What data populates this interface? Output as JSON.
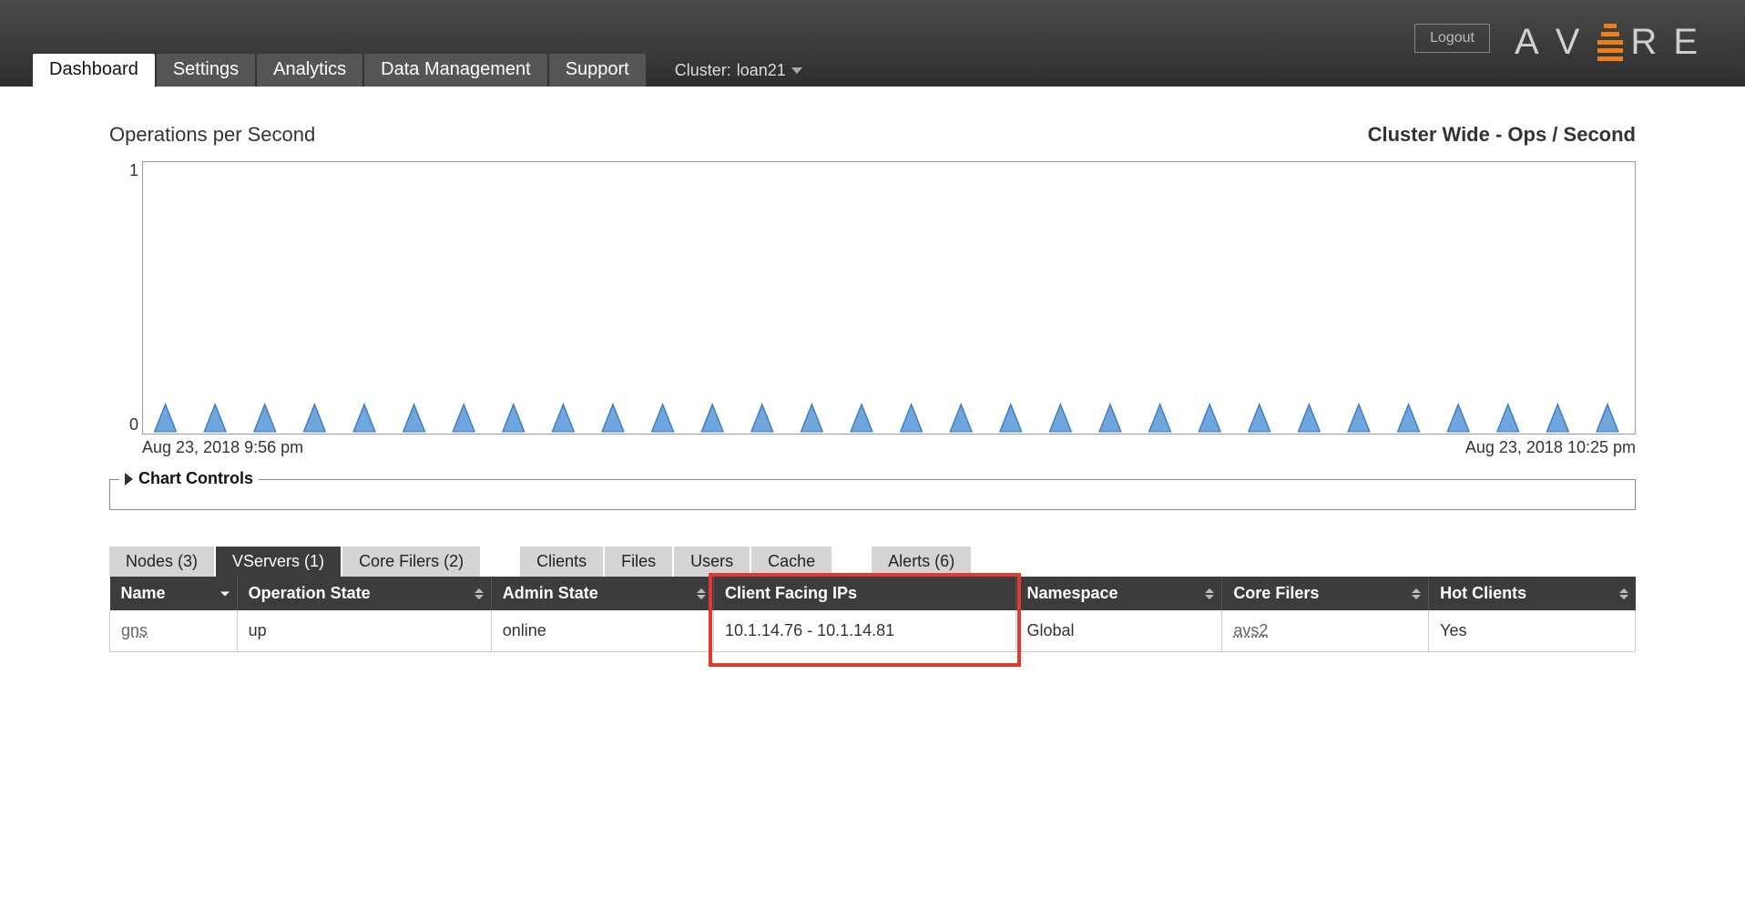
{
  "header": {
    "logout": "Logout",
    "cluster_label": "Cluster:",
    "cluster_name": "loan21",
    "tabs": [
      {
        "label": "Dashboard",
        "active": true
      },
      {
        "label": "Settings",
        "active": false
      },
      {
        "label": "Analytics",
        "active": false
      },
      {
        "label": "Data Management",
        "active": false
      },
      {
        "label": "Support",
        "active": false
      }
    ]
  },
  "chart": {
    "title": "Operations per Second",
    "subtitle": "Cluster Wide - Ops / Second",
    "y_min": "0",
    "y_max": "1",
    "x_start": "Aug 23, 2018 9:56 pm",
    "x_end": "Aug 23, 2018 10:25 pm",
    "controls_label": "Chart Controls"
  },
  "chart_data": {
    "type": "line",
    "title": "Operations per Second",
    "subtitle": "Cluster Wide - Ops / Second",
    "xlabel": "",
    "ylabel": "",
    "x_range": [
      "Aug 23, 2018 9:56 pm",
      "Aug 23, 2018 10:25 pm"
    ],
    "ylim": [
      0,
      1
    ],
    "series": [
      {
        "name": "Ops / Second",
        "note": "repeated short spikes roughly every minute, peaking well below 1",
        "approx_spike_count": 30,
        "approx_peak": 0.1
      }
    ]
  },
  "lower_tabs": [
    {
      "label": "Nodes (3)",
      "active": false
    },
    {
      "label": "VServers (1)",
      "active": true
    },
    {
      "label": "Core Filers (2)",
      "active": false
    },
    {
      "label": "Clients",
      "active": false,
      "gap_before": true
    },
    {
      "label": "Files",
      "active": false
    },
    {
      "label": "Users",
      "active": false
    },
    {
      "label": "Cache",
      "active": false
    },
    {
      "label": "Alerts (6)",
      "active": false,
      "gap_before": true
    }
  ],
  "table": {
    "columns": [
      {
        "label": "Name",
        "sorted": "desc"
      },
      {
        "label": "Operation State"
      },
      {
        "label": "Admin State"
      },
      {
        "label": "Client Facing IPs",
        "highlight": true
      },
      {
        "label": "Namespace"
      },
      {
        "label": "Core Filers"
      },
      {
        "label": "Hot Clients"
      }
    ],
    "rows": [
      {
        "name": "gns",
        "name_link": true,
        "operation_state": "up",
        "admin_state": "online",
        "client_facing_ips": "10.1.14.76 - 10.1.14.81",
        "namespace": "Global",
        "core_filers": "avs2",
        "core_filers_link": true,
        "hot_clients": "Yes"
      }
    ]
  }
}
